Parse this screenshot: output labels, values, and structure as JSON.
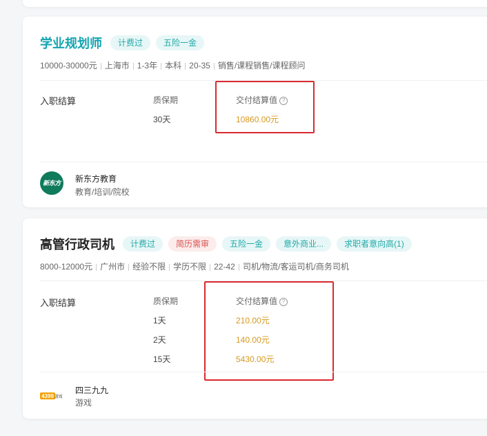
{
  "job1": {
    "title": "学业规划师",
    "tags": [
      "计费过",
      "五险一金"
    ],
    "meta": [
      "10000-30000元",
      "上海市",
      "1-3年",
      "本科",
      "20-35",
      "销售/课程销售/课程顾问"
    ],
    "settle_label": "入职结算",
    "col_period": "质保期",
    "col_value": "交付结算值",
    "rows": [
      {
        "period": "30天",
        "value": "10860.00元"
      }
    ],
    "company": {
      "name": "新东方教育",
      "industry": "教育/培训/院校",
      "logo_text": "新东方"
    }
  },
  "job2": {
    "title": "高管行政司机",
    "tags": [
      "计费过",
      "简历需审",
      "五险一金",
      "意外商业...",
      "求职者意向高(1)"
    ],
    "meta": [
      "8000-12000元",
      "广州市",
      "经验不限",
      "学历不限",
      "22-42",
      "司机/物流/客运司机/商务司机"
    ],
    "settle_label": "入职结算",
    "col_period": "质保期",
    "col_value": "交付结算值",
    "rows": [
      {
        "period": "1天",
        "value": "210.00元"
      },
      {
        "period": "2天",
        "value": "140.00元"
      },
      {
        "period": "15天",
        "value": "5430.00元"
      }
    ],
    "company": {
      "name": "四三九九",
      "industry": "游戏",
      "logo_text": "4399游戏"
    }
  },
  "icons": {
    "help": "question-circle-icon"
  },
  "colors": {
    "accent_teal": "#12a4b0",
    "price": "#d8991f",
    "highlight": "#d9292f",
    "tag_red": "#d9534f"
  }
}
